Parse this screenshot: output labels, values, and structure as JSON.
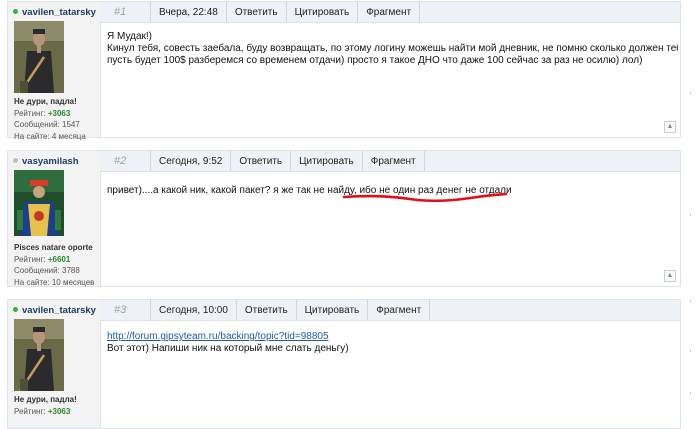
{
  "posts": [
    {
      "author": "vavilen_tatarsky",
      "status": "online",
      "number": "#1",
      "date": "Вчера, 22:48",
      "actions": [
        "Ответить",
        "Цитировать",
        "Фрагмент"
      ],
      "user_title": "Не дури, падла!",
      "rating_label": "Рейтинг:",
      "rating": "+3063",
      "messages": "Сообщений: 1547",
      "online_time": "На сайте: 4 месяца",
      "lines": [
        "Я Мудак!)",
        "Кинул тебя, совесть заебала, буду возвращать, по этому логину можешь найти мой дневник, не помню сколько должен тебе но",
        "пусть будет 100$ разберемся со временем отдачи) просто я такое ДНО что даже 100 сейчас за раз не осилю) лол)"
      ]
    },
    {
      "author": "vasyamilash",
      "status": "offline",
      "number": "#2",
      "date": "Сегодня, 9:52",
      "actions": [
        "Ответить",
        "Цитировать",
        "Фрагмент"
      ],
      "user_title": "Pisces natare oporte",
      "rating_label": "Рейтинг:",
      "rating": "+6601",
      "messages": "Сообщений: 3788",
      "online_time": "На сайте: 10 месяцев",
      "lines": [
        "привет)....а какой ник, какой пакет? я же так не найду, ибо не один раз денег не отдали"
      ]
    },
    {
      "author": "vavilen_tatarsky",
      "status": "online",
      "number": "#3",
      "date": "Сегодня, 10:00",
      "actions": [
        "Ответить",
        "Цитировать",
        "Фрагмент"
      ],
      "user_title": "Не дури, падла!",
      "rating_label": "Рейтинг:",
      "rating": "+3063",
      "link": "http://forum.gipsyteam.ru/backing/topic?tid=98805",
      "lines": [
        "Вот этот) Напиши ник на который мне слать деньгу)"
      ]
    }
  ],
  "colors": {
    "online": "#2fb33a",
    "offline": "#bdbdbd",
    "rating": "#2a8a2a",
    "annotation": "#e0101a",
    "link": "#1f5aa6"
  }
}
